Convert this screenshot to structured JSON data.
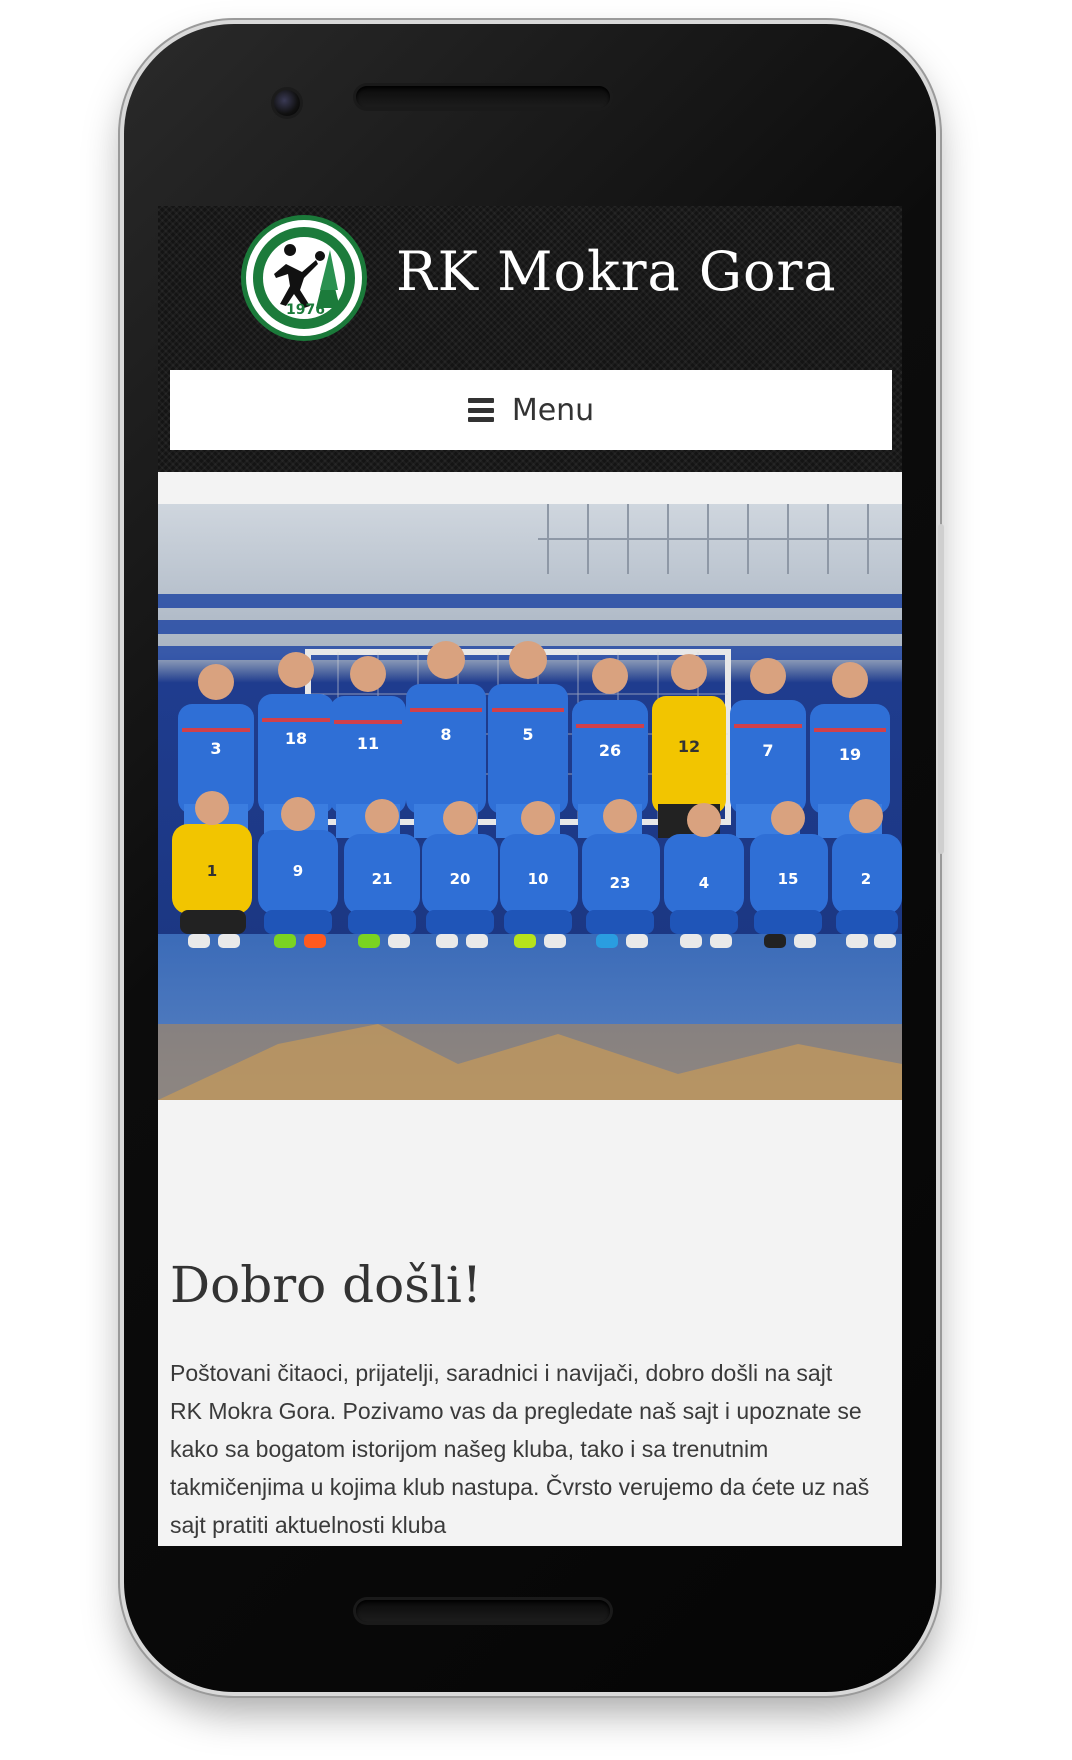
{
  "site": {
    "title": "RK Mokra Gora",
    "logo_text": "RK MOKRA GORA · 1976"
  },
  "nav": {
    "menu_label": "Menu",
    "menu_icon": "hamburger-icon"
  },
  "hero": {
    "image_subject": "team-photo"
  },
  "welcome": {
    "title": "Dobro došli!",
    "text": "Poštovani čitaoci, prijatelji, saradnici i navijači, dobro došli na sajt RK Mokra Gora. Pozivamo vas da pregledate naš sajt i upoznate se kako sa bogatom istorijom našeg kluba, tako i sa trenutnim takmičenjima u kojima klub nastupa. Čvrsto verujemo da ćete uz naš sajt pratiti aktuelnosti kluba"
  },
  "colors": {
    "header_bg": "#141414",
    "logo_green": "#1c7b3b",
    "page_bg": "#f3f3f3",
    "jersey_blue": "#2f6fd6",
    "goalkeeper_yellow": "#f2c500"
  }
}
